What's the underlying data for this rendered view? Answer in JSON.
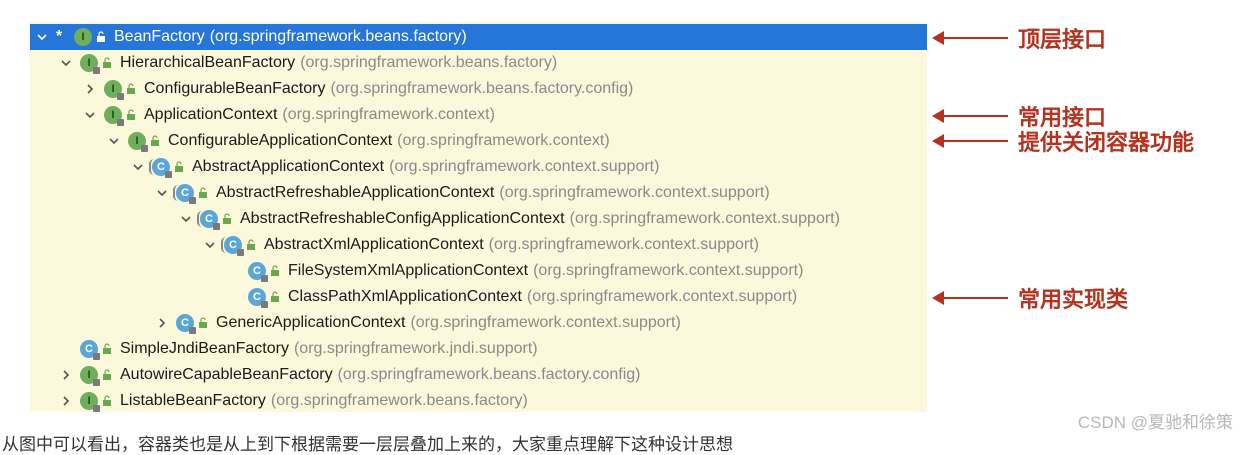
{
  "tree": {
    "rows": [
      {
        "name": "BeanFactory",
        "pkg": "(org.springframework.beans.factory)",
        "type": "iface",
        "arrow": "down",
        "star": "*",
        "selected": true
      },
      {
        "name": "HierarchicalBeanFactory",
        "pkg": "(org.springframework.beans.factory)",
        "type": "iface",
        "arrow": "down"
      },
      {
        "name": "ConfigurableBeanFactory",
        "pkg": "(org.springframework.beans.factory.config)",
        "type": "iface",
        "arrow": "right"
      },
      {
        "name": "ApplicationContext",
        "pkg": "(org.springframework.context)",
        "type": "iface",
        "arrow": "down"
      },
      {
        "name": "ConfigurableApplicationContext",
        "pkg": "(org.springframework.context)",
        "type": "iface",
        "arrow": "down"
      },
      {
        "name": "AbstractApplicationContext",
        "pkg": "(org.springframework.context.support)",
        "type": "abs",
        "arrow": "down"
      },
      {
        "name": "AbstractRefreshableApplicationContext",
        "pkg": "(org.springframework.context.support)",
        "type": "abs",
        "arrow": "down"
      },
      {
        "name": "AbstractRefreshableConfigApplicationContext",
        "pkg": "(org.springframework.context.support)",
        "type": "abs",
        "arrow": "down"
      },
      {
        "name": "AbstractXmlApplicationContext",
        "pkg": "(org.springframework.context.support)",
        "type": "abs",
        "arrow": "down"
      },
      {
        "name": "FileSystemXmlApplicationContext",
        "pkg": "(org.springframework.context.support)",
        "type": "cls",
        "arrow": "none"
      },
      {
        "name": "ClassPathXmlApplicationContext",
        "pkg": "(org.springframework.context.support)",
        "type": "cls",
        "arrow": "none"
      },
      {
        "name": "GenericApplicationContext",
        "pkg": "(org.springframework.context.support)",
        "type": "cls",
        "arrow": "right"
      },
      {
        "name": "SimpleJndiBeanFactory",
        "pkg": "(org.springframework.jndi.support)",
        "type": "cls",
        "arrow": "none"
      },
      {
        "name": "AutowireCapableBeanFactory",
        "pkg": "(org.springframework.beans.factory.config)",
        "type": "iface",
        "arrow": "right"
      },
      {
        "name": "ListableBeanFactory",
        "pkg": "(org.springframework.beans.factory)",
        "type": "iface",
        "arrow": "right"
      }
    ]
  },
  "annotations": {
    "top_interface": "顶层接口",
    "common_interface": "常用接口",
    "close_feature": "提供关闭容器功能",
    "common_impl": "常用实现类"
  },
  "icons": {
    "interface": "interface-icon",
    "class": "class-icon",
    "abstract_class": "abstract-class-icon",
    "visibility": "public-visibility-icon",
    "expand": "chevron-down-icon",
    "collapse": "chevron-right-icon"
  },
  "colors": {
    "selected_bg": "#2675d9",
    "panel_bg": "#fcf8dc",
    "annotation": "#b5321e"
  },
  "footer": {
    "watermark": "CSDN @夏驰和徐策",
    "text": "从图中可以看出，容器类也是从上到下根据需要一层层叠加上来的，大家重点理解下这种设计思想"
  }
}
